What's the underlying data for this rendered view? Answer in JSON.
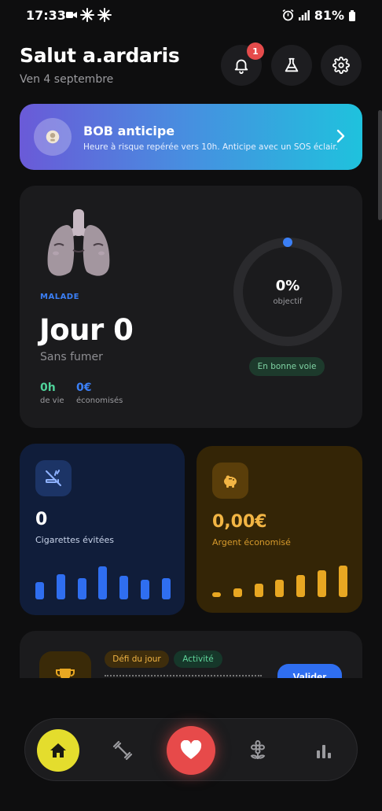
{
  "status_bar": {
    "time": "17:33",
    "battery": "81%"
  },
  "header": {
    "greeting": "Salut a.ardaris",
    "date": "Ven 4 septembre",
    "notification_count": "1"
  },
  "bob": {
    "title": "BOB anticipe",
    "text": "Heure à risque repérée vers 10h. Anticipe avec un SOS éclair."
  },
  "main": {
    "status_label": "MALADE",
    "day_title": "Jour 0",
    "day_subtitle": "Sans fumer",
    "life_value": "0h",
    "life_label": "de vie",
    "saved_value": "0€",
    "saved_label": "économisés",
    "objective_percent": "0%",
    "objective_label": "objectif",
    "objective_progress": 0,
    "status_pill": "En bonne voie"
  },
  "cigarettes": {
    "value": "0",
    "label": "Cigarettes évitées",
    "bars": [
      22,
      32,
      27,
      42,
      30,
      25,
      27
    ]
  },
  "money": {
    "value": "0,00€",
    "label": "Argent économisé",
    "bars": [
      6,
      11,
      17,
      22,
      28,
      34,
      40
    ]
  },
  "challenge": {
    "tag_defi": "Défi du jour",
    "tag_activity": "Activité",
    "validate_label": "Valider"
  },
  "colors": {
    "accent_blue": "#3b7ff5",
    "cig_bar": "#2f6ef0",
    "money_bar": "#e8a722",
    "nav_home": "#e4dd2d",
    "nav_heart": "#e74a4a"
  },
  "nav": [
    "home-icon",
    "dumbbell-icon",
    "heart-icon",
    "flower-icon",
    "bar-chart-icon"
  ]
}
